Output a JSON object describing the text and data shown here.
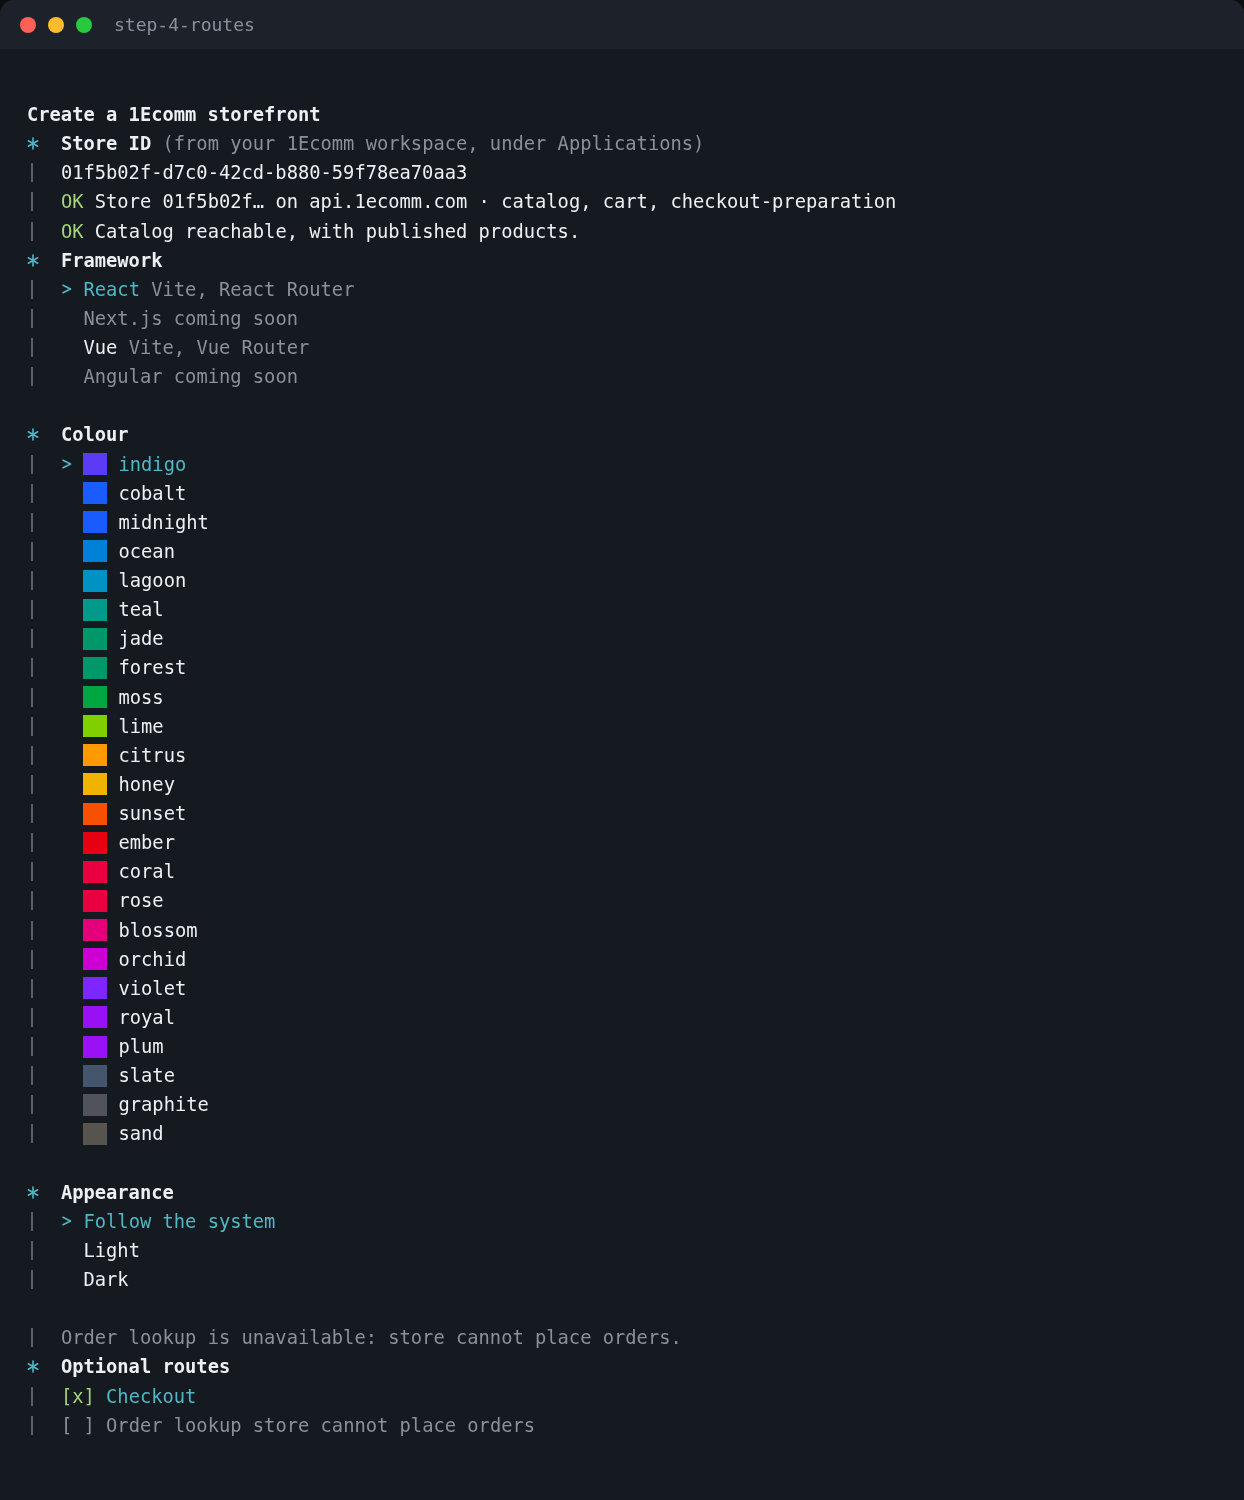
{
  "window": {
    "title": "step-4-routes"
  },
  "heading": "Create a 1Ecomm storefront",
  "sections": [
    {
      "kind": "input",
      "label": "Store ID",
      "hint": "(from your 1Ecomm workspace, under Applications)",
      "value": "01f5b02f-d7c0-42cd-b880-59f78ea70aa3",
      "checks": [
        {
          "status": "OK",
          "text": "Store 01f5b02f… on api.1ecomm.com · catalog, cart, checkout-preparation"
        },
        {
          "status": "OK",
          "text": "Catalog reachable, with published products."
        }
      ]
    },
    {
      "kind": "choice",
      "label": "Framework",
      "options": [
        {
          "label": "React",
          "detail": "Vite, React Router",
          "selected": true,
          "disabled": false
        },
        {
          "label": "Next.js",
          "detail": "coming soon",
          "selected": false,
          "disabled": true
        },
        {
          "label": "Vue",
          "detail": "Vite, Vue Router",
          "selected": false,
          "disabled": false
        },
        {
          "label": "Angular",
          "detail": "coming soon",
          "selected": false,
          "disabled": true
        }
      ]
    },
    {
      "kind": "swatches",
      "label": "Colour",
      "options": [
        {
          "label": "indigo",
          "color": "#5b3cf5",
          "selected": true
        },
        {
          "label": "cobalt",
          "color": "#1a5cff",
          "selected": false
        },
        {
          "label": "midnight",
          "color": "#1a5bfe",
          "selected": false
        },
        {
          "label": "ocean",
          "color": "#0080d8",
          "selected": false
        },
        {
          "label": "lagoon",
          "color": "#0092c2",
          "selected": false
        },
        {
          "label": "teal",
          "color": "#00998a",
          "selected": false
        },
        {
          "label": "jade",
          "color": "#009868",
          "selected": false
        },
        {
          "label": "forest",
          "color": "#009869",
          "selected": false
        },
        {
          "label": "moss",
          "color": "#00a640",
          "selected": false
        },
        {
          "label": "lime",
          "color": "#80d000",
          "selected": false
        },
        {
          "label": "citrus",
          "color": "#ff9900",
          "selected": false
        },
        {
          "label": "honey",
          "color": "#f0b400",
          "selected": false
        },
        {
          "label": "sunset",
          "color": "#f75000",
          "selected": false
        },
        {
          "label": "ember",
          "color": "#e60012",
          "selected": false
        },
        {
          "label": "coral",
          "color": "#ea0040",
          "selected": false
        },
        {
          "label": "rose",
          "color": "#ea0041",
          "selected": false
        },
        {
          "label": "blossom",
          "color": "#e4007a",
          "selected": false
        },
        {
          "label": "orchid",
          "color": "#cc00d4",
          "selected": false
        },
        {
          "label": "violet",
          "color": "#7d26ff",
          "selected": false
        },
        {
          "label": "royal",
          "color": "#9a10f5",
          "selected": false
        },
        {
          "label": "plum",
          "color": "#9a11f5",
          "selected": false
        },
        {
          "label": "slate",
          "color": "#45556e",
          "selected": false
        },
        {
          "label": "graphite",
          "color": "#52525c",
          "selected": false
        },
        {
          "label": "sand",
          "color": "#57534d",
          "selected": false
        }
      ]
    },
    {
      "kind": "choice",
      "label": "Appearance",
      "options": [
        {
          "label": "Follow the system",
          "selected": true,
          "disabled": false
        },
        {
          "label": "Light",
          "selected": false,
          "disabled": false
        },
        {
          "label": "Dark",
          "selected": false,
          "disabled": false
        }
      ]
    },
    {
      "kind": "note",
      "text": "Order lookup is unavailable: store cannot place orders."
    },
    {
      "kind": "checklist",
      "label": "Optional routes",
      "options": [
        {
          "box": "[x]",
          "label": "Checkout",
          "checked": true,
          "disabled": false
        },
        {
          "box": "[ ]",
          "label": "Order lookup",
          "detail": "store cannot place orders",
          "checked": false,
          "disabled": true
        }
      ]
    }
  ]
}
